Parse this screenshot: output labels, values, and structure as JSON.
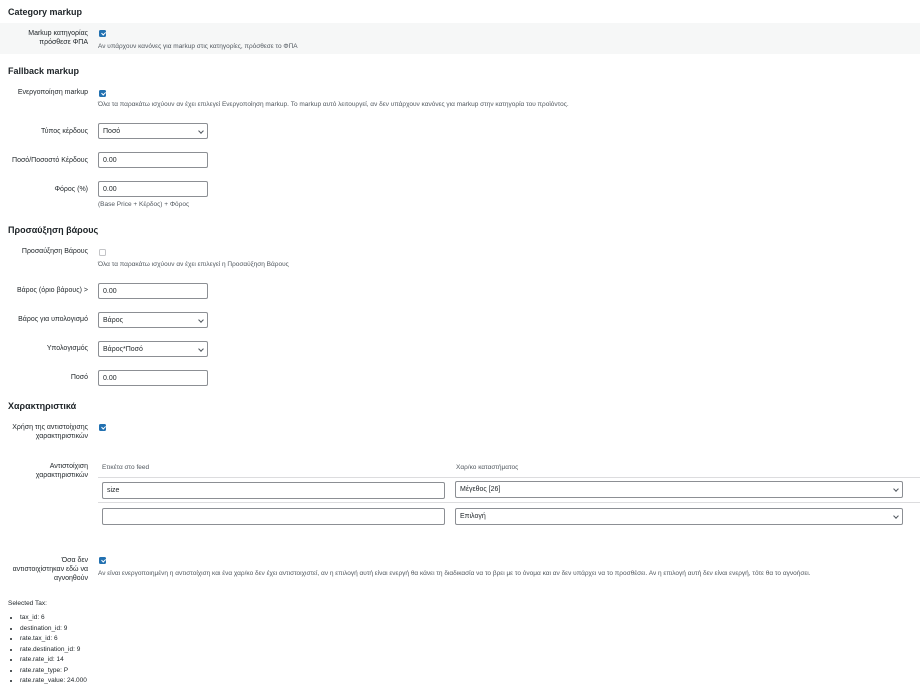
{
  "category_markup": {
    "heading": "Category markup",
    "label_line1": "Markup κατηγορίας",
    "label_line2": "πρόσθεσε ΦΠΑ",
    "checked": true,
    "description": "Αν υπάρχουν κανόνες για markup στις κατηγορίες, πρόσθεσε το ΦΠΑ"
  },
  "fallback_markup": {
    "heading": "Fallback markup",
    "enable_label": "Ενεργοποίηση markup",
    "enable_checked": true,
    "enable_description": "Όλα τα παρακάτω ισχύουν αν έχει επιλεγεί Ενεργοποίηση markup. Το markup αυτό λειτουργεί, αν δεν υπάρχουν κανόνες για markup στην κατηγορία του προϊόντος.",
    "profit_type_label": "Τύπος κέρδους",
    "profit_type_value": "Ποσό",
    "profit_amount_label": "Ποσό/Ποσοστό Κέρδους",
    "profit_amount_value": "0.00",
    "tax_label": "Φόρος (%)",
    "tax_value": "0.00",
    "tax_description": "(Base Price + Κέρδος) + Φόρος"
  },
  "weight_surcharge": {
    "heading": "Προσαύξηση βάρους",
    "enable_label": "Προσαύξηση Βάρους",
    "enable_checked": false,
    "enable_description": "Όλα τα παρακάτω ισχύουν αν έχει επιλεγεί η Προσαύξηση Βάρους",
    "weight_threshold_label": "Βάρος (όριο βάρους) >",
    "weight_threshold_value": "0.00",
    "weight_for_calc_label": "Βάρος για υπολογισμό",
    "weight_for_calc_value": "Βάρος",
    "calculation_label": "Υπολογισμός",
    "calculation_value": "Βάρος*Ποσό",
    "amount_label": "Ποσό",
    "amount_value": "0.00"
  },
  "attributes": {
    "heading": "Χαρακτηριστικά",
    "use_mapping_label_line1": "Χρήση της αντιστοίχισης",
    "use_mapping_label_line2": "χαρακτηριστικών",
    "use_mapping_checked": true,
    "mapping_label_line1": "Αντιστοίχιση",
    "mapping_label_line2": "χαρακτηριστικών",
    "col_feed_label": "Ετικέτα στο feed",
    "col_store_attr": "Χαρ/κο καταστήματος",
    "rows": [
      {
        "feed_label": "size",
        "store_attr": "Μέγεθος [26]"
      },
      {
        "feed_label": "",
        "store_attr": "Επιλογή"
      }
    ],
    "unmapped_label_line1": "Όσα δεν",
    "unmapped_label_line2": "αντιστοιχίστηκαν εδώ να",
    "unmapped_label_line3": "αγνοηθούν",
    "unmapped_checked": true,
    "unmapped_description": "Αν είναι ενεργοποιημένη η αντιστοίχιση και ένα χαρ/κο δεν έχει αντιστοιχιστεί, αν η επιλογή αυτή είναι ενεργή θα κάνει τη διαδικασία να το βρει με το όνομα και αν δεν υπάρχει να το προσθέσει. Αν η επιλογή αυτή δεν είναι ενεργή, τότε θα το αγνοήσει."
  },
  "selected_tax": {
    "heading": "Selected Tax:",
    "items": [
      "tax_id: 6",
      "destination_id: 9",
      "rate.tax_id: 6",
      "rate.destination_id: 9",
      "rate.rate_id: 14",
      "rate.rate_type: P",
      "rate.rate_value: 24.000"
    ]
  },
  "colors": {
    "accent": "#2271b1",
    "row_background": "#f6f7f7",
    "border": "#8c8f94"
  },
  "icons": {
    "checkbox": "checkmark",
    "select": "chevron-down-icon"
  }
}
